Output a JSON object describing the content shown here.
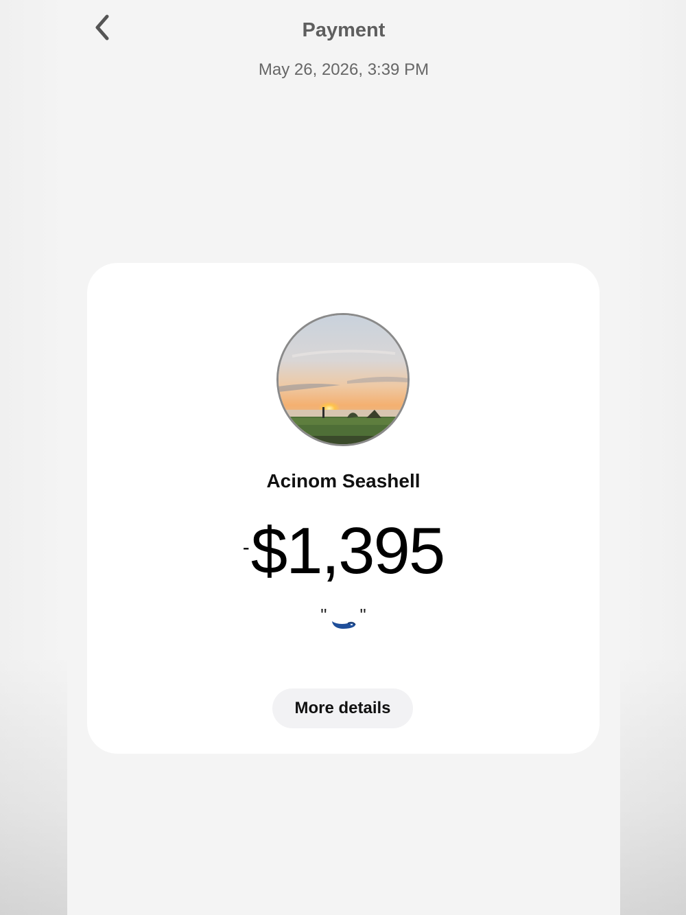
{
  "header": {
    "title": "Payment",
    "date": "May 26, 2026, 3:39 PM",
    "back_icon": "chevron-left-icon"
  },
  "transaction": {
    "recipient_name": "Acinom Seashell",
    "amount_sign": "-",
    "amount": "$1,395",
    "note_open_quote": "\"",
    "note_close_quote": "\"",
    "note_emoji": "shoe-emoji"
  },
  "actions": {
    "more_details_label": "More details"
  },
  "colors": {
    "background": "#f4f4f4",
    "card": "#ffffff",
    "button": "#f2f2f4",
    "text_primary": "#111111",
    "text_secondary": "#666666"
  }
}
